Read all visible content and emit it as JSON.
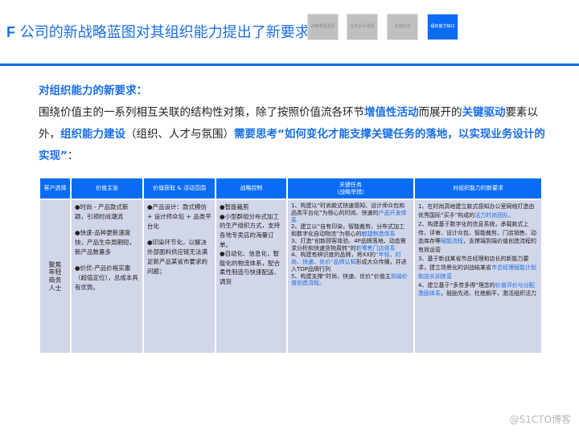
{
  "header": {
    "title_prefix": "F",
    "title": "公司的新战略蓝图对其组织能力提出了新要求"
  },
  "nav": [
    {
      "label": "战略意图澄清",
      "active": false
    },
    {
      "label": "业务设计澄清",
      "active": false
    },
    {
      "label": "关键任务",
      "active": false
    },
    {
      "label": "组织能力缺口",
      "active": true
    }
  ],
  "intro": {
    "heading": "对组织能力的新要求：",
    "segments": [
      {
        "t": "围绕价值主的一系列相互关联的结构性对策，除了按照价值流各环节",
        "h": false
      },
      {
        "t": "增值性活动",
        "h": true
      },
      {
        "t": "而展开的",
        "h": false
      },
      {
        "t": "关键驱动",
        "h": true
      },
      {
        "t": "要素以外，",
        "h": false
      },
      {
        "t": "组织能力建设",
        "h": true
      },
      {
        "t": "（组织、人才与氛围）",
        "h": false
      },
      {
        "t": "需要思考“如何变化才能支撑关键任务的落地，以实现业务设计的实现”",
        "h": true
      },
      {
        "t": "：",
        "h": false
      }
    ]
  },
  "table": {
    "headers": [
      "客户选择",
      "价值主张",
      "价值获取 & 活动范围",
      "战略控制",
      "关键任务\n（战略举措）",
      "对组织能力的新要求"
    ],
    "segment": "聚焦年轻商务人士",
    "value_prop": [
      "●时尚 - 产品款式新颖，引领时尚潮流",
      "●快速-品种更新速度快，产品生命周期短，新产品数量多",
      "●价优-产品价格实惠（超值定位），总成本具有优势。"
    ],
    "value_capture": [
      "●产品设计：款式模仿 + 设计师众包 + 品类平台化",
      "●印染环节化，以解决外部面料供应链无法满足新产品某省市要求的问题；"
    ],
    "strategic_control": [
      "●智能裁剪",
      "●小型群组分布式加工的生产组织方式，支持各地专卖店的海量订单。",
      "●自动化、信息化，智能化的物流体系，配合柔性制造与快速配送、调货"
    ],
    "key_tasks": [
      [
        {
          "t": "1、构建以“时尚款式快速感知、设计师众包和品类平台化”为核心的时尚、快速的",
          "h": false
        },
        {
          "t": "产品开发体系",
          "h": true
        }
      ],
      [
        {
          "t": "2、建立以“自有印染，智能裁剪、分布式加工和数字化自动物流”为核心的",
          "h": false
        },
        {
          "t": "敏捷制造体系",
          "h": true
        }
      ],
      [
        {
          "t": "3、打造“创新顾客体验、4P品牌落地、动态需求分析和快速货物周转”的",
          "h": false
        },
        {
          "t": "新零售门店体系",
          "h": true
        }
      ],
      [
        {
          "t": "4、构建有辨识度的品牌，将XX的",
          "h": false
        },
        {
          "t": "“年轻，时尚、快速、优价”品牌认知",
          "h": true
        },
        {
          "t": "形成大众传播，并进入TOP品牌行列",
          "h": false
        }
      ],
      [
        {
          "t": "5、构建支撑“时尚、快速、优价”价值主",
          "h": false
        },
        {
          "t": "到端价值创造流程。",
          "h": true
        }
      ]
    ],
    "org_requirements": [
      [
        {
          "t": "1、在时尚高地建立款式感知办公室网络打造由优秀国际“买手”构成的",
          "h": false
        },
        {
          "t": "活力时尚团队。",
          "h": true
        }
      ],
      [
        {
          "t": "2、构建基于数字化的信息系统，承载款式上传、评审、设计众包、智能裁剪、门店销售、动态库存等",
          "h": false
        },
        {
          "t": "赋能流程",
          "h": true
        },
        {
          "t": "，支撑端到端价值创造流程的有效运营",
          "h": false
        }
      ],
      [
        {
          "t": "3、基于新战某省市总经理和店长的新能力要求，建立场景化的训战结某省",
          "h": false
        },
        {
          "t": "市总经理赋能计划和店长训练营",
          "h": true
        }
      ],
      [
        {
          "t": "4、建立基于“多劳多得”理念的",
          "h": false
        },
        {
          "t": "价值评价与分配激励体系",
          "h": true
        },
        {
          "t": "，鼓励先进、杜绝躺平，激活组织活力",
          "h": false
        }
      ]
    ]
  },
  "watermark": "@51CTO博客"
}
